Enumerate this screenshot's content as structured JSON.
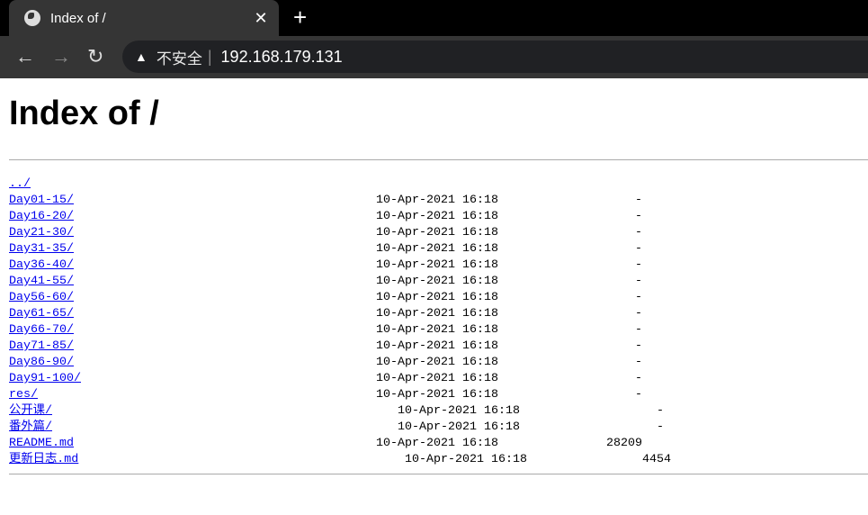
{
  "browser": {
    "tab_title": "Index of /",
    "security_label": "不安全",
    "url": "192.168.179.131",
    "icons": {
      "tab": "globe-icon",
      "close": "close-icon",
      "new_tab": "plus-icon",
      "back": "arrow-left-icon",
      "forward": "arrow-right-icon",
      "reload": "reload-icon",
      "warning": "warning-triangle-icon"
    }
  },
  "page": {
    "title": "Index of /",
    "parent": "../",
    "entries": [
      {
        "name": "Day01-15/",
        "date": "10-Apr-2021 16:18",
        "size": "-"
      },
      {
        "name": "Day16-20/",
        "date": "10-Apr-2021 16:18",
        "size": "-"
      },
      {
        "name": "Day21-30/",
        "date": "10-Apr-2021 16:18",
        "size": "-"
      },
      {
        "name": "Day31-35/",
        "date": "10-Apr-2021 16:18",
        "size": "-"
      },
      {
        "name": "Day36-40/",
        "date": "10-Apr-2021 16:18",
        "size": "-"
      },
      {
        "name": "Day41-55/",
        "date": "10-Apr-2021 16:18",
        "size": "-"
      },
      {
        "name": "Day56-60/",
        "date": "10-Apr-2021 16:18",
        "size": "-"
      },
      {
        "name": "Day61-65/",
        "date": "10-Apr-2021 16:18",
        "size": "-"
      },
      {
        "name": "Day66-70/",
        "date": "10-Apr-2021 16:18",
        "size": "-"
      },
      {
        "name": "Day71-85/",
        "date": "10-Apr-2021 16:18",
        "size": "-"
      },
      {
        "name": "Day86-90/",
        "date": "10-Apr-2021 16:18",
        "size": "-"
      },
      {
        "name": "Day91-100/",
        "date": "10-Apr-2021 16:18",
        "size": "-"
      },
      {
        "name": "res/",
        "date": "10-Apr-2021 16:18",
        "size": "-"
      },
      {
        "name": "公开课/",
        "date": "10-Apr-2021 16:18",
        "size": "-"
      },
      {
        "name": "番外篇/",
        "date": "10-Apr-2021 16:18",
        "size": "-"
      },
      {
        "name": "README.md",
        "date": "10-Apr-2021 16:18",
        "size": "28209"
      },
      {
        "name": "更新日志.md",
        "date": "10-Apr-2021 16:18",
        "size": "4454"
      }
    ]
  }
}
